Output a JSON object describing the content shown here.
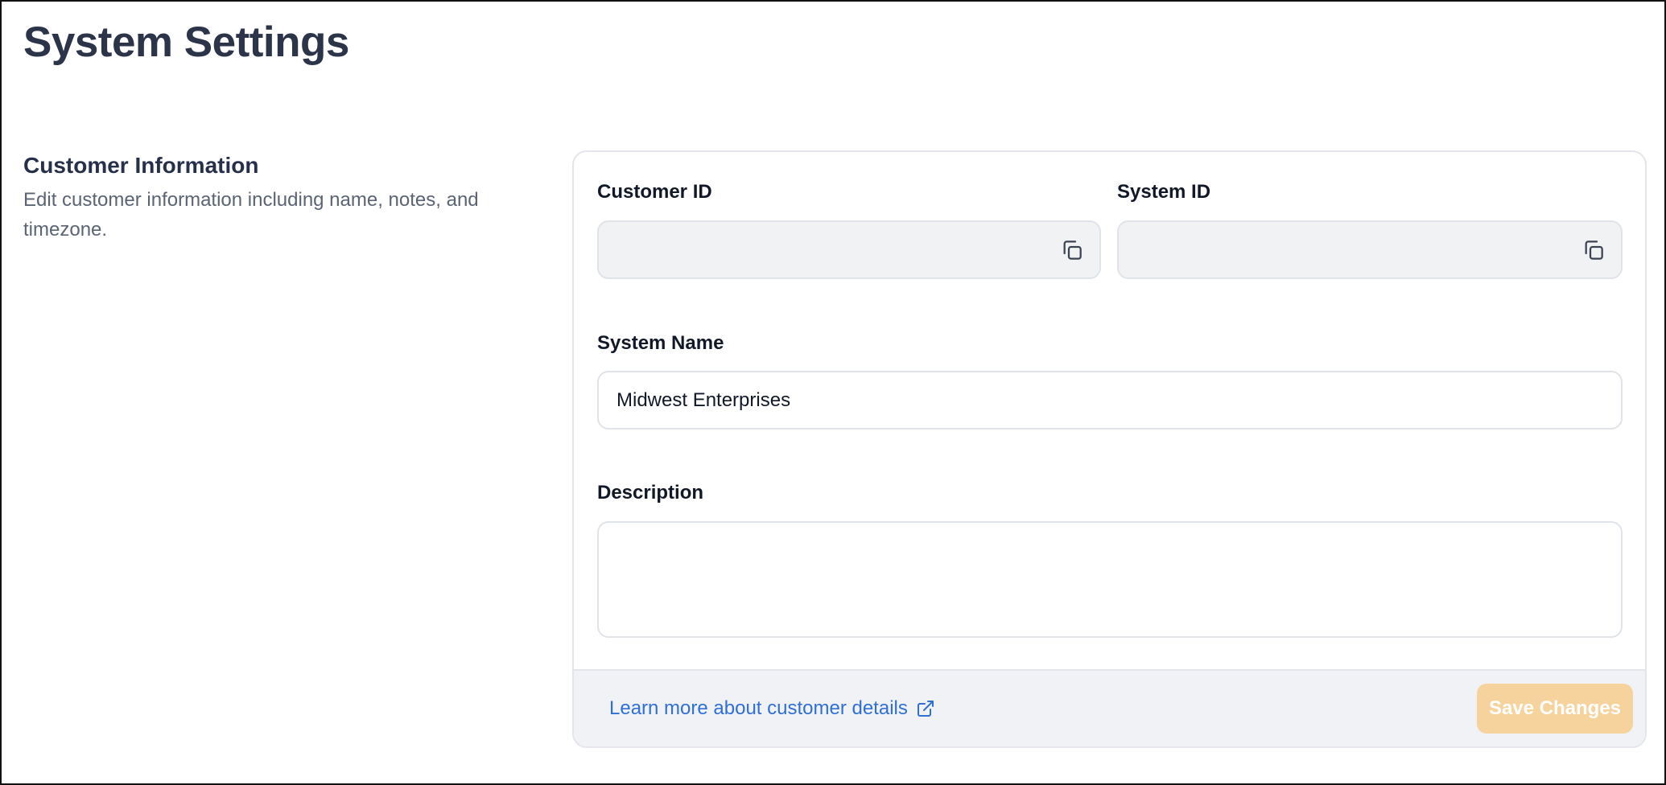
{
  "page": {
    "title": "System Settings"
  },
  "section": {
    "title": "Customer Information",
    "description": "Edit customer information including name, notes, and timezone."
  },
  "form": {
    "customer_id": {
      "label": "Customer ID",
      "value": "",
      "copy_icon": "copy-icon"
    },
    "system_id": {
      "label": "System ID",
      "value": "",
      "copy_icon": "copy-icon"
    },
    "system_name": {
      "label": "System Name",
      "value": "Midwest Enterprises"
    },
    "description": {
      "label": "Description",
      "value": ""
    }
  },
  "footer": {
    "learn_more_link": "Learn more about customer details",
    "external_icon": "external-link-icon",
    "save_label": "Save Changes"
  },
  "colors": {
    "title": "#2b3448",
    "link": "#2f6fd6",
    "save_button_disabled": "#f6d39d",
    "readonly_field_bg": "#f1f2f4",
    "footer_bg": "#f1f2f5"
  }
}
